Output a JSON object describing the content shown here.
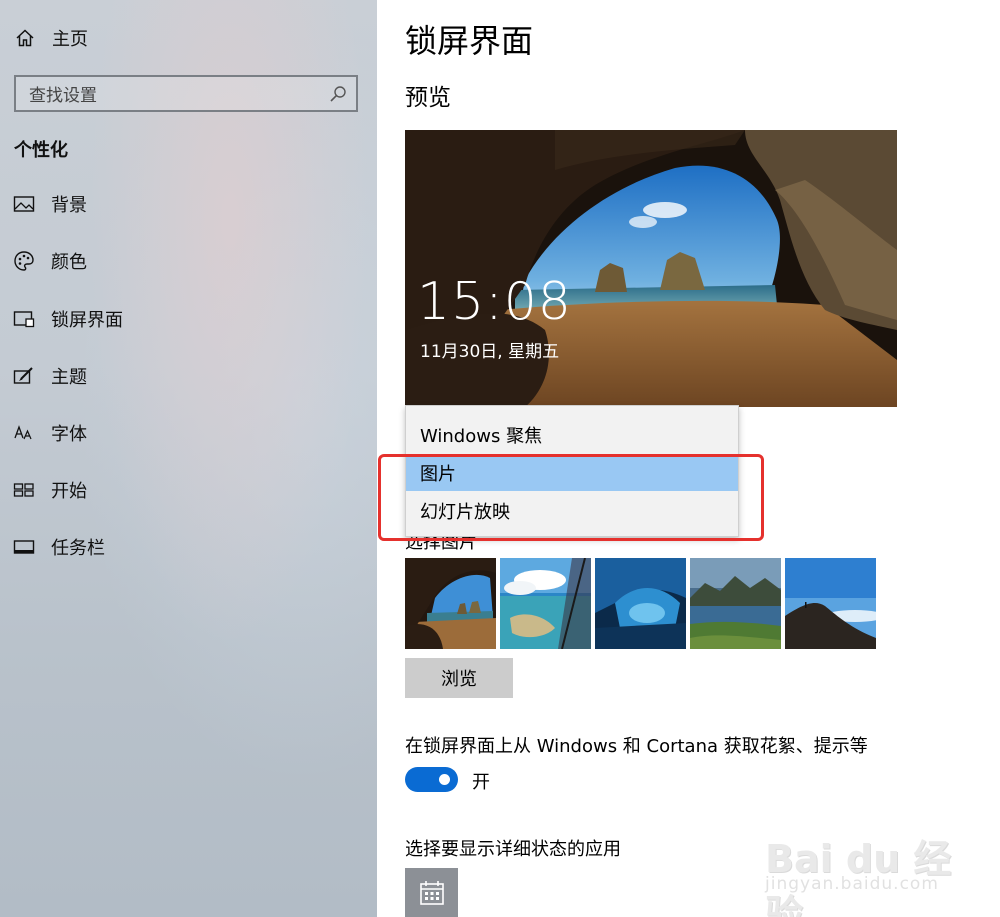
{
  "sidebar": {
    "home_label": "主页",
    "search_placeholder": "查找设置",
    "section_title": "个性化",
    "items": [
      {
        "label": "背景",
        "icon": "image-icon"
      },
      {
        "label": "颜色",
        "icon": "palette-icon"
      },
      {
        "label": "锁屏界面",
        "icon": "lock-screen-icon"
      },
      {
        "label": "主题",
        "icon": "theme-icon"
      },
      {
        "label": "字体",
        "icon": "font-icon"
      },
      {
        "label": "开始",
        "icon": "start-icon"
      },
      {
        "label": "任务栏",
        "icon": "taskbar-icon"
      }
    ]
  },
  "main": {
    "title": "锁屏界面",
    "preview_heading": "预览",
    "preview": {
      "time": "15:08",
      "date": "11月30日, 星期五"
    },
    "background_dropdown": {
      "options": [
        "Windows 聚焦",
        "图片",
        "幻灯片放映"
      ],
      "selected": "图片"
    },
    "choose_picture_label": "选择图片",
    "browse_button": "浏览",
    "tips_label": "在锁屏界面上从 Windows 和 Cortana 获取花絮、提示等",
    "tips_toggle": {
      "state_label": "开",
      "on": true
    },
    "detailed_status_label": "选择要显示详细状态的应用"
  },
  "watermark": {
    "brand": "Bai du 经验",
    "url": "jingyan.baidu.com"
  },
  "colors": {
    "accent": "#0a6bd3",
    "dropdown_selected": "#99c8f3",
    "annotation_red": "#e5312d"
  }
}
